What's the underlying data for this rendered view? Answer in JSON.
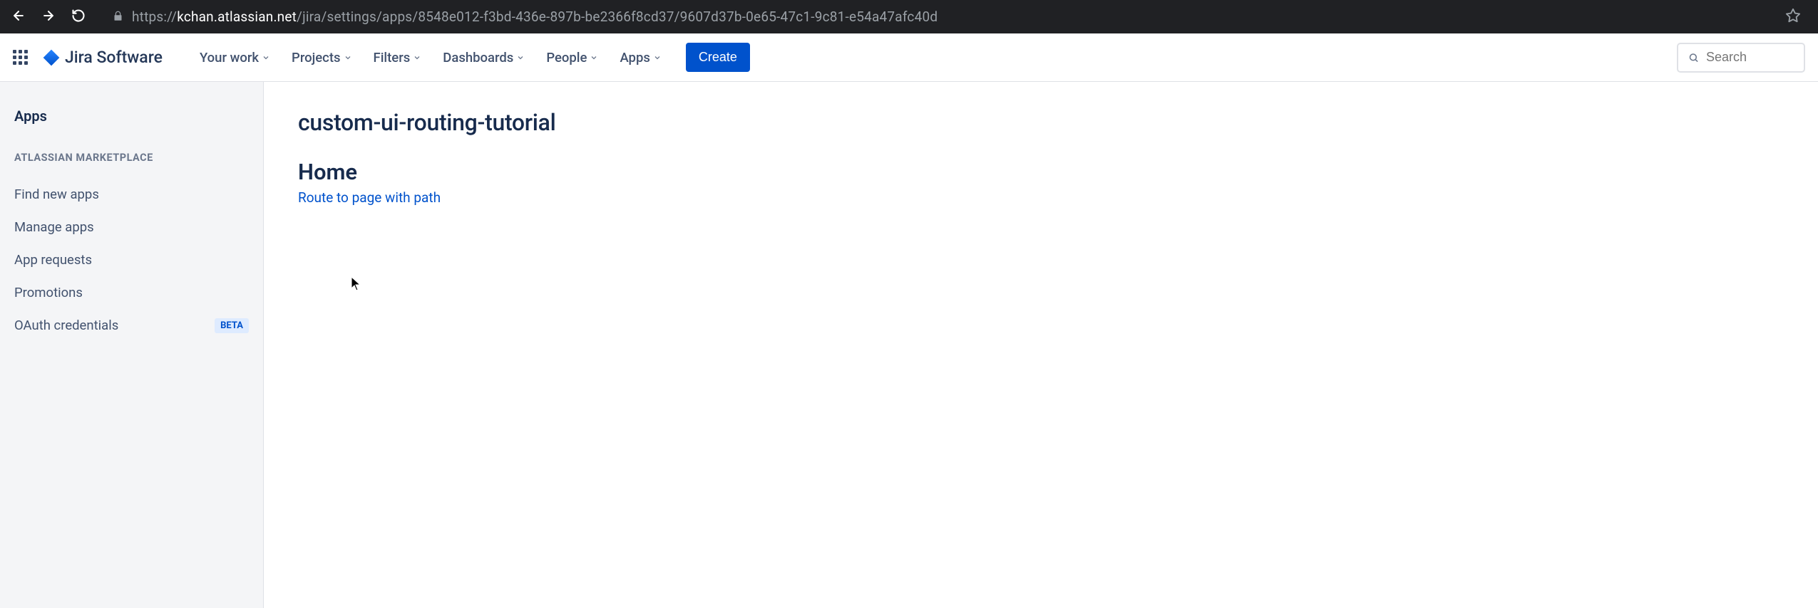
{
  "browser": {
    "url_full": "https://kchan.atlassian.net/jira/settings/apps/8548e012-f3bd-436e-897b-be2366f8cd37/9607d37b-0e65-47c1-9c81-e54a47afc40d",
    "url_domain": "kchan.atlassian.net",
    "url_path": "/jira/settings/apps/8548e012-f3bd-436e-897b-be2366f8cd37/9607d37b-0e65-47c1-9c81-e54a47afc40d"
  },
  "header": {
    "product": "Jira Software",
    "nav": [
      {
        "label": "Your work"
      },
      {
        "label": "Projects"
      },
      {
        "label": "Filters"
      },
      {
        "label": "Dashboards"
      },
      {
        "label": "People"
      },
      {
        "label": "Apps"
      }
    ],
    "create_label": "Create",
    "search_placeholder": "Search"
  },
  "sidebar": {
    "title": "Apps",
    "section_heading": "ATLASSIAN MARKETPLACE",
    "items": [
      {
        "label": "Find new apps"
      },
      {
        "label": "Manage apps"
      },
      {
        "label": "App requests"
      },
      {
        "label": "Promotions"
      },
      {
        "label": "OAuth credentials",
        "badge": "BETA"
      }
    ]
  },
  "main": {
    "title": "custom-ui-routing-tutorial",
    "subpage": "Home",
    "link": "Route to page with path"
  }
}
